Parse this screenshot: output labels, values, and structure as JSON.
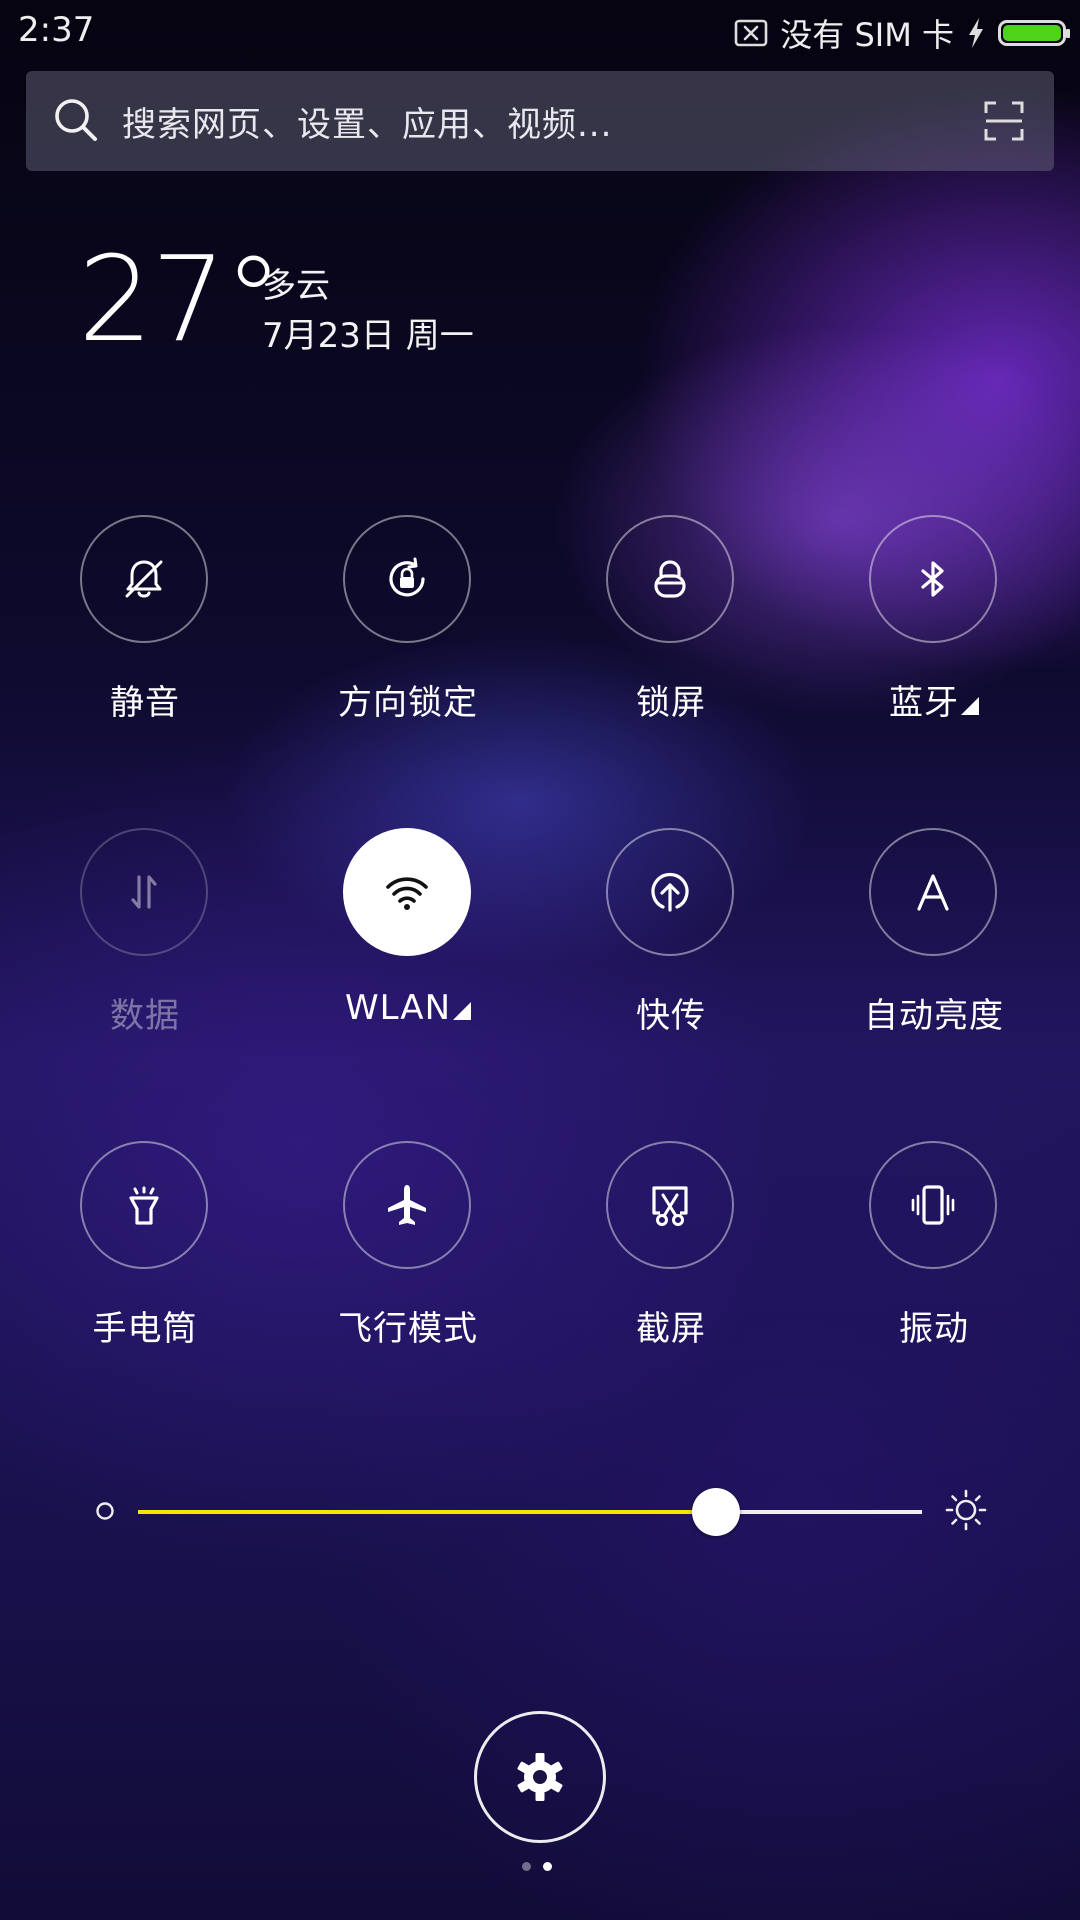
{
  "status_bar": {
    "time": "2:37",
    "sim_status": "没有 SIM 卡",
    "battery_level": 1.0,
    "battery_color": "#4fd31a",
    "icons": [
      "no-sim-icon",
      "charging-bolt-icon",
      "battery-icon"
    ]
  },
  "search": {
    "placeholder": "搜索网页、设置、应用、视频...",
    "icons": [
      "search-icon",
      "scan-icon"
    ]
  },
  "weather": {
    "temperature": "27°",
    "condition": "多云",
    "date": "7月23日 周一"
  },
  "toggles": [
    {
      "id": "silent",
      "label": "静音",
      "icon": "bell-off-icon",
      "state": "off",
      "has_submenu": false
    },
    {
      "id": "rotation-lock",
      "label": "方向锁定",
      "icon": "rotation-lock-icon",
      "state": "off",
      "has_submenu": false
    },
    {
      "id": "lock-screen",
      "label": "锁屏",
      "icon": "lock-icon",
      "state": "off",
      "has_submenu": false
    },
    {
      "id": "bluetooth",
      "label": "蓝牙",
      "icon": "bluetooth-icon",
      "state": "off",
      "has_submenu": true
    },
    {
      "id": "mobile-data",
      "label": "数据",
      "icon": "data-arrows-icon",
      "state": "disabled",
      "has_submenu": false
    },
    {
      "id": "wlan",
      "label": "WLAN",
      "icon": "wifi-icon",
      "state": "on",
      "has_submenu": true
    },
    {
      "id": "quick-transfer",
      "label": "快传",
      "icon": "upload-icon",
      "state": "off",
      "has_submenu": false
    },
    {
      "id": "auto-brightness",
      "label": "自动亮度",
      "icon": "auto-brightness-icon",
      "state": "off",
      "has_submenu": false
    },
    {
      "id": "flashlight",
      "label": "手电筒",
      "icon": "flashlight-icon",
      "state": "off",
      "has_submenu": false
    },
    {
      "id": "airplane",
      "label": "飞行模式",
      "icon": "airplane-icon",
      "state": "off",
      "has_submenu": false
    },
    {
      "id": "screenshot",
      "label": "截屏",
      "icon": "scissors-icon",
      "state": "off",
      "has_submenu": false
    },
    {
      "id": "vibrate",
      "label": "振动",
      "icon": "vibrate-icon",
      "state": "off",
      "has_submenu": false
    }
  ],
  "brightness": {
    "level": 0.737,
    "fill_color": "#f4e600",
    "icons": [
      "brightness-low-icon",
      "brightness-high-icon"
    ]
  },
  "settings": {
    "icon": "gear-icon"
  },
  "pager": {
    "count": 2,
    "active_index": 1
  }
}
